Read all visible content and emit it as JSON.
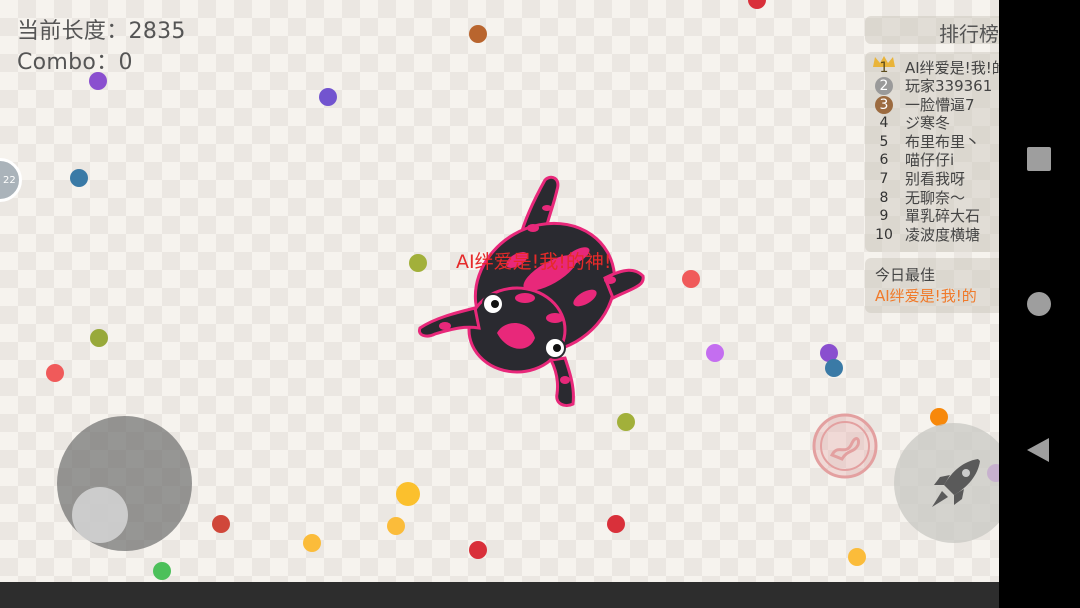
{
  "hud": {
    "length_label": "当前长度：",
    "length_value": "2835",
    "combo_label": "Combo：",
    "combo_value": "0"
  },
  "leaderboard": {
    "title": "排行榜",
    "entries": [
      {
        "rank": "1",
        "name": "AI绊爱是!我!的"
      },
      {
        "rank": "2",
        "name": "玩家339361"
      },
      {
        "rank": "3",
        "name": "一脸懵逼7"
      },
      {
        "rank": "4",
        "name": "ジ寒冬"
      },
      {
        "rank": "5",
        "name": "布里布里丶"
      },
      {
        "rank": "6",
        "name": "喵仔仔i"
      },
      {
        "rank": "7",
        "name": "别看我呀"
      },
      {
        "rank": "8",
        "name": "无聊奈～"
      },
      {
        "rank": "9",
        "name": "單乳碎大石"
      },
      {
        "rank": "10",
        "name": "凌波度横塘"
      }
    ]
  },
  "best_today": {
    "label": "今日最佳",
    "name": "AI绊爱是!我!的"
  },
  "player": {
    "name": "AI绊爱是!我!的神!",
    "skin_colors": {
      "body": "#2a2a30",
      "spots": "#e8287a"
    }
  },
  "offscreen_marker": {
    "label": "22"
  },
  "controls": {
    "joystick": "joystick",
    "boost_icon": "rocket-icon",
    "skill_icon": "dragon-emblem-icon"
  },
  "system_nav": {
    "recents": "square-icon",
    "home": "circle-icon",
    "back": "triangle-back-icon"
  },
  "colors": {
    "accent_orange": "#f07a2a",
    "name_red": "#e62a2a",
    "medal_gold": "#e9b43a",
    "medal_silver": "#9a9a9a",
    "medal_bronze": "#9c6b40"
  }
}
